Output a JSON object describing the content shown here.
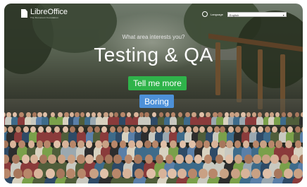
{
  "header": {
    "logo_name_part1": "Libre",
    "logo_name_part2": "Office",
    "logo_tagline": "The Document Foundation",
    "language_label": "Language",
    "language_selected": "English"
  },
  "hero": {
    "question": "What area interests you?",
    "title": "Testing & QA",
    "primary_button": "Tell me more",
    "secondary_button": "Boring"
  },
  "colors": {
    "primary_button": "#2fb34a",
    "secondary_button": "#4d90d8"
  }
}
